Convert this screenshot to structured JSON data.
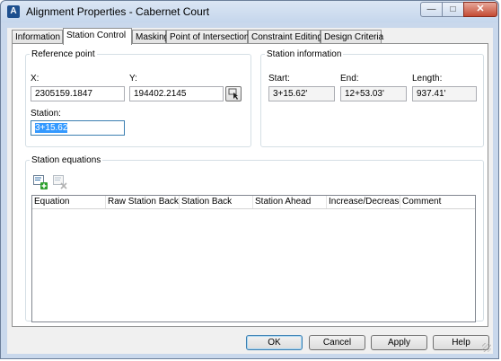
{
  "window": {
    "title": "Alignment Properties - Cabernet Court",
    "app_icon_glyph": "A"
  },
  "caption_buttons": {
    "minimize": "—",
    "maximize": "□",
    "close": "✕"
  },
  "tabs": [
    {
      "label": "Information"
    },
    {
      "label": "Station Control"
    },
    {
      "label": "Masking"
    },
    {
      "label": "Point of Intersection"
    },
    {
      "label": "Constraint Editing"
    },
    {
      "label": "Design Criteria"
    }
  ],
  "active_tab": "Station Control",
  "reference_point": {
    "legend": "Reference point",
    "x_label": "X:",
    "x_value": "2305159.1847",
    "y_label": "Y:",
    "y_value": "194402.2145",
    "station_label": "Station:",
    "station_value": "3+15.62"
  },
  "station_information": {
    "legend": "Station information",
    "start_label": "Start:",
    "start_value": "3+15.62'",
    "end_label": "End:",
    "end_value": "12+53.03'",
    "length_label": "Length:",
    "length_value": "937.41'"
  },
  "station_equations": {
    "legend": "Station equations",
    "columns": [
      "Equation",
      "Raw Station Back",
      "Station Back",
      "Station Ahead",
      "Increase/Decrease",
      "Comment"
    ],
    "rows": []
  },
  "buttons": {
    "ok": "OK",
    "cancel": "Cancel",
    "apply": "Apply",
    "help": "Help"
  }
}
